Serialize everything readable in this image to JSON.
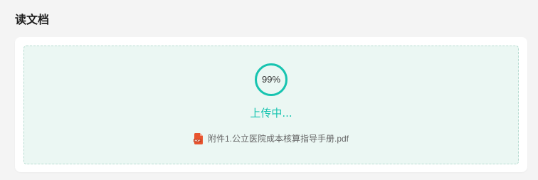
{
  "page": {
    "title": "读文档"
  },
  "upload": {
    "progress_percent": 99,
    "progress_label": "99%",
    "status": "上传中...",
    "file_name": "附件1.公立医院成本核算指导手册.pdf",
    "file_icon": "pdf-file-icon"
  },
  "colors": {
    "accent": "#17c4b0",
    "ring_track": "#e3efec",
    "dropzone_bg": "#ebf7f3",
    "dropzone_border": "#b7dcd1",
    "pdf_icon": "#e8552f"
  }
}
